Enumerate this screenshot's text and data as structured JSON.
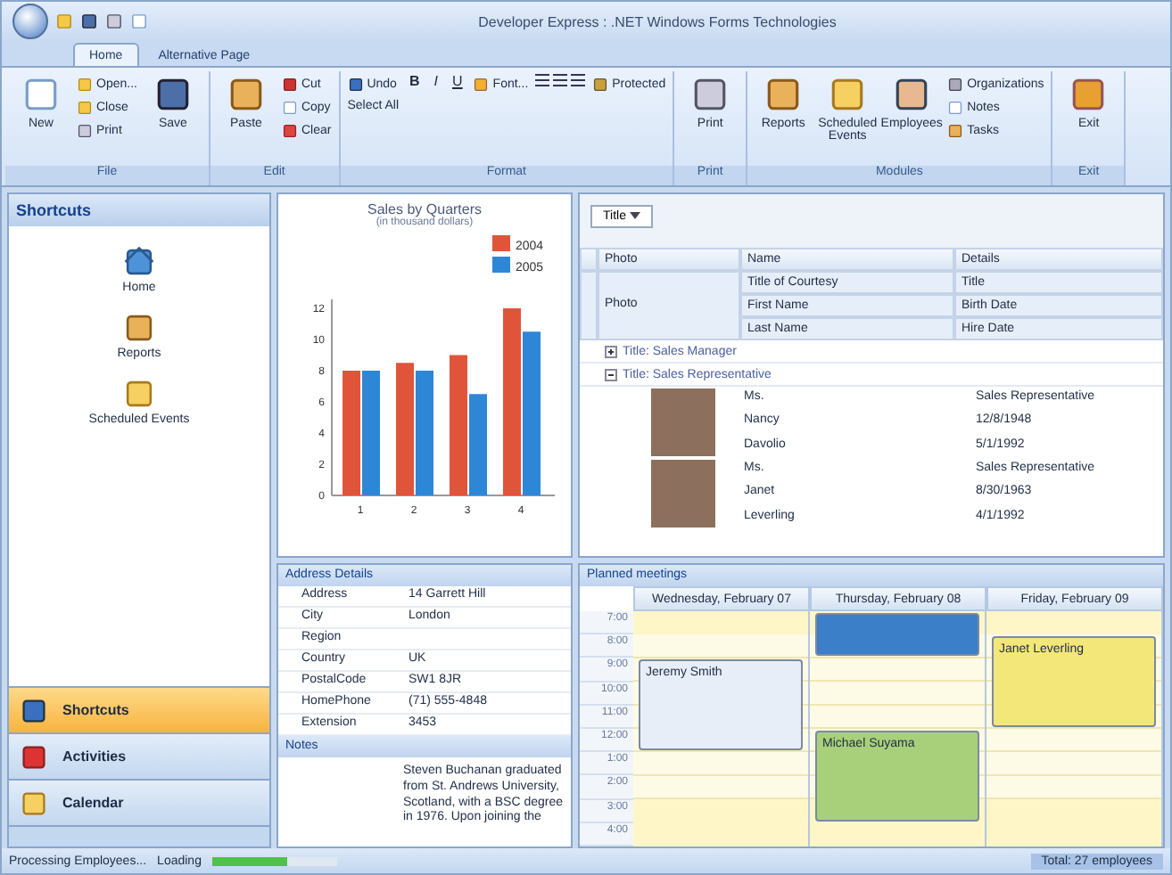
{
  "window": {
    "title": "Developer Express : .NET Windows Forms Technologies"
  },
  "ribbon_tabs": [
    {
      "label": "Home",
      "selected": true
    },
    {
      "label": "Alternative Page",
      "selected": false
    }
  ],
  "ribbon_groups": [
    {
      "label": "File",
      "items": [
        {
          "label": "New",
          "kind": "large"
        },
        {
          "label": "Open...",
          "kind": "small"
        },
        {
          "label": "Close",
          "kind": "small"
        },
        {
          "label": "Print",
          "kind": "small"
        },
        {
          "label": "Save",
          "kind": "large"
        }
      ]
    },
    {
      "label": "Edit",
      "items": [
        {
          "label": "Paste",
          "kind": "large"
        },
        {
          "label": "Cut",
          "kind": "small"
        },
        {
          "label": "Copy",
          "kind": "small"
        },
        {
          "label": "Clear",
          "kind": "small"
        }
      ]
    },
    {
      "label": "Format",
      "items": [
        {
          "label": "Undo",
          "kind": "small"
        },
        {
          "label": "Select All",
          "kind": "small"
        },
        {
          "label": "B",
          "kind": "glyph"
        },
        {
          "label": "I",
          "kind": "glyph"
        },
        {
          "label": "U",
          "kind": "glyph"
        },
        {
          "label": "Font...",
          "kind": "small"
        },
        {
          "kind": "align"
        },
        {
          "label": "Protected",
          "kind": "small"
        }
      ]
    },
    {
      "label": "Print",
      "items": [
        {
          "label": "Print",
          "kind": "large"
        }
      ]
    },
    {
      "label": "Modules",
      "items": [
        {
          "label": "Reports",
          "kind": "large"
        },
        {
          "label": "Scheduled Events",
          "kind": "large"
        },
        {
          "label": "Employees",
          "kind": "large"
        },
        {
          "label": "Organizations",
          "kind": "small"
        },
        {
          "label": "Notes",
          "kind": "small"
        },
        {
          "label": "Tasks",
          "kind": "small"
        }
      ]
    },
    {
      "label": "Exit",
      "items": [
        {
          "label": "Exit",
          "kind": "large"
        }
      ]
    }
  ],
  "navbar": {
    "title": "Shortcuts",
    "items": [
      {
        "label": "Home"
      },
      {
        "label": "Reports"
      },
      {
        "label": "Scheduled Events"
      }
    ],
    "groups": [
      {
        "label": "Shortcuts",
        "selected": true
      },
      {
        "label": "Activities",
        "selected": false
      },
      {
        "label": "Calendar",
        "selected": false
      }
    ]
  },
  "chart_panel": {
    "chart_data": {
      "type": "bar",
      "title": "Sales by Quarters",
      "subtitle": "(in thousand dollars)",
      "legend": "top-right",
      "categories": [
        "1",
        "2",
        "3",
        "4"
      ],
      "yticks": [
        0,
        2,
        4,
        6,
        8,
        10,
        12
      ],
      "ylim": [
        0,
        12
      ],
      "series": [
        {
          "name": "2004",
          "color": "#e0553a",
          "values": [
            8,
            8.5,
            9,
            12
          ]
        },
        {
          "name": "2005",
          "color": "#2e86d6",
          "values": [
            8,
            8,
            6.5,
            10.5
          ]
        }
      ]
    }
  },
  "grid": {
    "group_by": "Title",
    "columns": [
      "Photo",
      "Name",
      "Details"
    ],
    "band_label": "Photo",
    "band_rows": [
      [
        "Title of Courtesy",
        "Title"
      ],
      [
        "First Name",
        "Birth Date"
      ],
      [
        "Last Name",
        "Hire Date"
      ]
    ],
    "groups": [
      {
        "label": "Title: Sales Manager",
        "expanded": false
      },
      {
        "label": "Title: Sales Representative",
        "expanded": true,
        "records": [
          {
            "name": [
              "Ms.",
              "Nancy",
              "Davolio"
            ],
            "details": [
              "Sales Representative",
              "12/8/1948",
              "5/1/1992"
            ]
          },
          {
            "name": [
              "Ms.",
              "Janet",
              "Leverling"
            ],
            "details": [
              "Sales Representative",
              "8/30/1963",
              "4/1/1992"
            ]
          }
        ]
      }
    ]
  },
  "address": {
    "title": "Address Details",
    "rows": [
      [
        "Address",
        "14 Garrett Hill"
      ],
      [
        "City",
        "London"
      ],
      [
        "Region",
        ""
      ],
      [
        "Country",
        "UK"
      ],
      [
        "PostalCode",
        "SW1 8JR"
      ],
      [
        "HomePhone",
        "(71) 555-4848"
      ],
      [
        "Extension",
        "3453"
      ]
    ]
  },
  "notes": {
    "title": "Notes",
    "text": "Steven Buchanan graduated from St. Andrews University, Scotland, with a BSC degree in 1976. Upon joining the"
  },
  "scheduler": {
    "title": "Planned meetings",
    "times": [
      "7:00",
      "8:00",
      "9:00",
      "10:00",
      "11:00",
      "12:00",
      "1:00",
      "2:00",
      "3:00",
      "4:00"
    ],
    "days": [
      {
        "label": "Wednesday, February 07",
        "appointments": [
          {
            "subject": "Jeremy Smith",
            "color": "#e8eef8"
          }
        ]
      },
      {
        "label": "Thursday, February 08",
        "appointments": [
          {
            "color": "#3b7fc8"
          },
          {
            "subject": "Michael Suyama",
            "color": "#a8d07a"
          }
        ]
      },
      {
        "label": "Friday, February 09",
        "appointments": [
          {
            "subject": "Janet Leverling",
            "color": "#f4e77a"
          }
        ]
      }
    ]
  },
  "status_bar": {
    "text": "Processing Employees...",
    "loading_label": "Loading",
    "level": 0.6,
    "total": "Total: 27 employees"
  }
}
